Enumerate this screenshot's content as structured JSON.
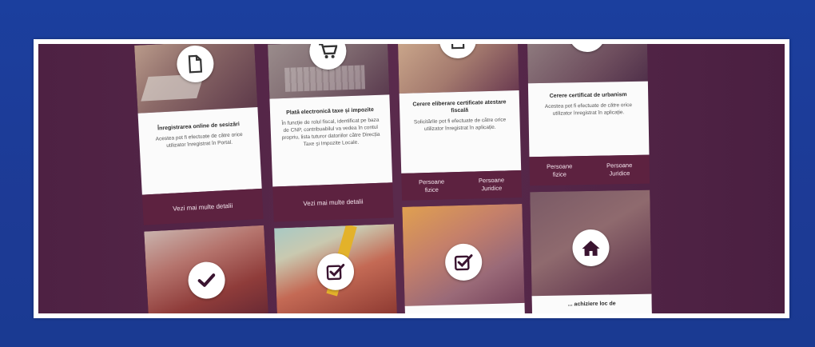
{
  "cards": [
    {
      "title": "Înregistrarea online de sesizări",
      "text": "Acestea pot fi efectuate de către orice utilizator înregistrat în Portal.",
      "button": "Vezi mai multe detalii",
      "icon": "document-icon"
    },
    {
      "title": "Plată electronică taxe și impozite",
      "text": "În funcție de rolul fiscal, identificat pe baza de CNP, contribuabilul va vedea în contul propriu, lista tuturor datoriilor către Direcția Taxe și Impozite Locale.",
      "button": "Vezi mai multe detalii",
      "icon": "shopping-cart-icon"
    },
    {
      "title": "Cerere eliberare certificate atestare fiscală",
      "text": "Solicitările pot fi efectuate de către orice utilizator înregistrat în aplicație.",
      "options": [
        "Persoane fizice",
        "Persoane Juridice"
      ],
      "icon": "document-icon"
    },
    {
      "title": "Cerere certificat de urbanism",
      "text": "Acestea pot fi efectuate de către orice utilizator înregistrat în aplicație.",
      "options": [
        "Persoane fizice",
        "Persoane Juridice"
      ],
      "icon": "document-icon"
    }
  ],
  "bottom_row": [
    {
      "icon": "checkmark-icon"
    },
    {
      "icon": "checkbox-check-icon"
    },
    {
      "icon": "checkbox-check-icon"
    },
    {
      "icon": "home-icon",
      "partial_title": "... achiziere loc de"
    }
  ]
}
